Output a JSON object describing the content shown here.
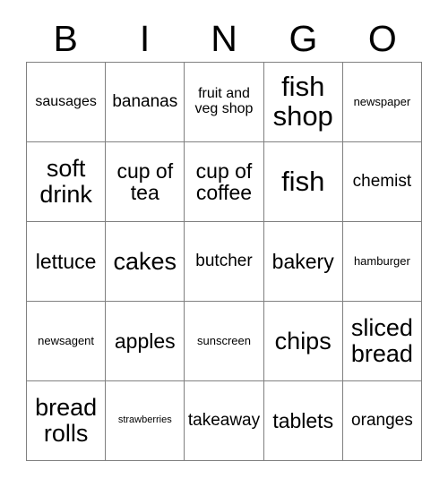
{
  "card": {
    "title": "BINGO",
    "header_letters": [
      "B",
      "I",
      "N",
      "G",
      "O"
    ],
    "grid_size": "5x5",
    "colors": {
      "background": "#ffffff",
      "text": "#000000",
      "grid_line": "#808080"
    },
    "rows": [
      [
        {
          "label": "sausages",
          "size": "sm"
        },
        {
          "label": "bananas",
          "size": "md"
        },
        {
          "label": "fruit and veg shop",
          "size": "sm"
        },
        {
          "label": "fish shop",
          "size": "xxl"
        },
        {
          "label": "newspaper",
          "size": "xs"
        }
      ],
      [
        {
          "label": "soft drink",
          "size": "xl"
        },
        {
          "label": "cup of tea",
          "size": "lg"
        },
        {
          "label": "cup of coffee",
          "size": "lg"
        },
        {
          "label": "fish",
          "size": "xxl"
        },
        {
          "label": "chemist",
          "size": "md"
        }
      ],
      [
        {
          "label": "lettuce",
          "size": "lg"
        },
        {
          "label": "cakes",
          "size": "xl"
        },
        {
          "label": "butcher",
          "size": "md"
        },
        {
          "label": "bakery",
          "size": "lg"
        },
        {
          "label": "hamburger",
          "size": "xs"
        }
      ],
      [
        {
          "label": "newsagent",
          "size": "xs"
        },
        {
          "label": "apples",
          "size": "lg"
        },
        {
          "label": "sunscreen",
          "size": "xs"
        },
        {
          "label": "chips",
          "size": "xl"
        },
        {
          "label": "sliced bread",
          "size": "xl"
        }
      ],
      [
        {
          "label": "bread rolls",
          "size": "xl"
        },
        {
          "label": "strawberries",
          "size": "xxs"
        },
        {
          "label": "takeaway",
          "size": "md"
        },
        {
          "label": "tablets",
          "size": "lg"
        },
        {
          "label": "oranges",
          "size": "md"
        }
      ]
    ]
  }
}
